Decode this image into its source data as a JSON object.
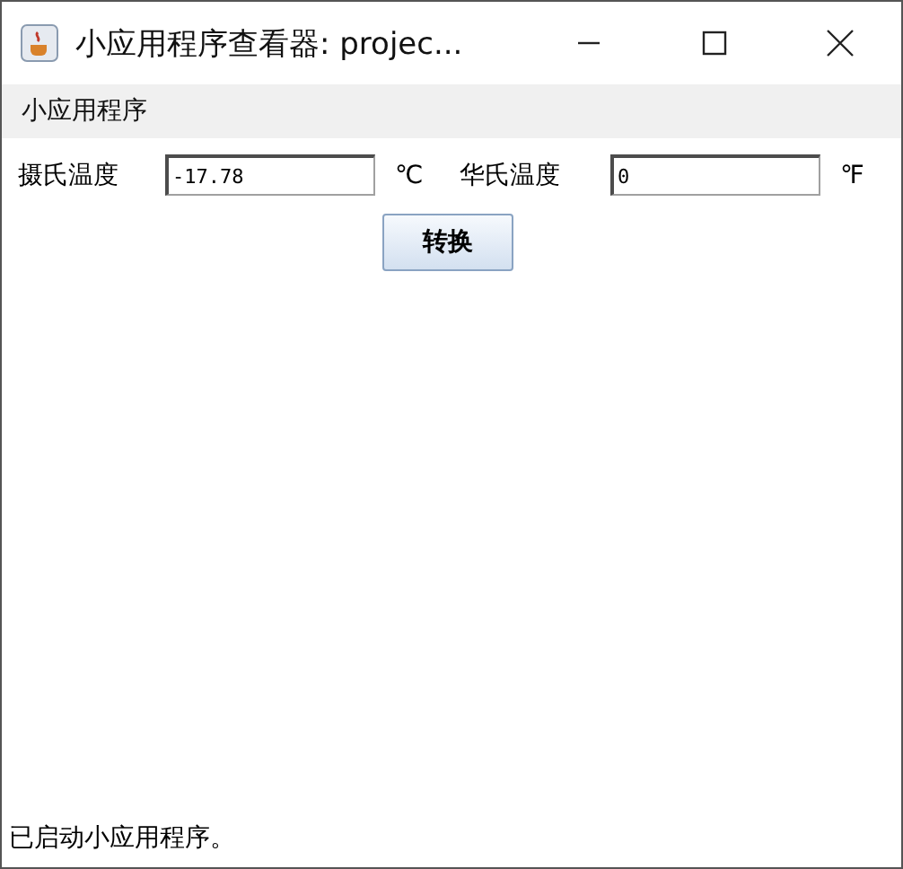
{
  "window": {
    "title": "小应用程序查看器: projec..."
  },
  "menu": {
    "label": "小应用程序"
  },
  "fields": [
    {
      "label": "摄氏温度",
      "value": "-17.78",
      "unit": "℃"
    },
    {
      "label": "华氏温度",
      "value": "0",
      "unit": "℉"
    }
  ],
  "button": {
    "label": "转换"
  },
  "status_bar": "已启动小应用程序。"
}
